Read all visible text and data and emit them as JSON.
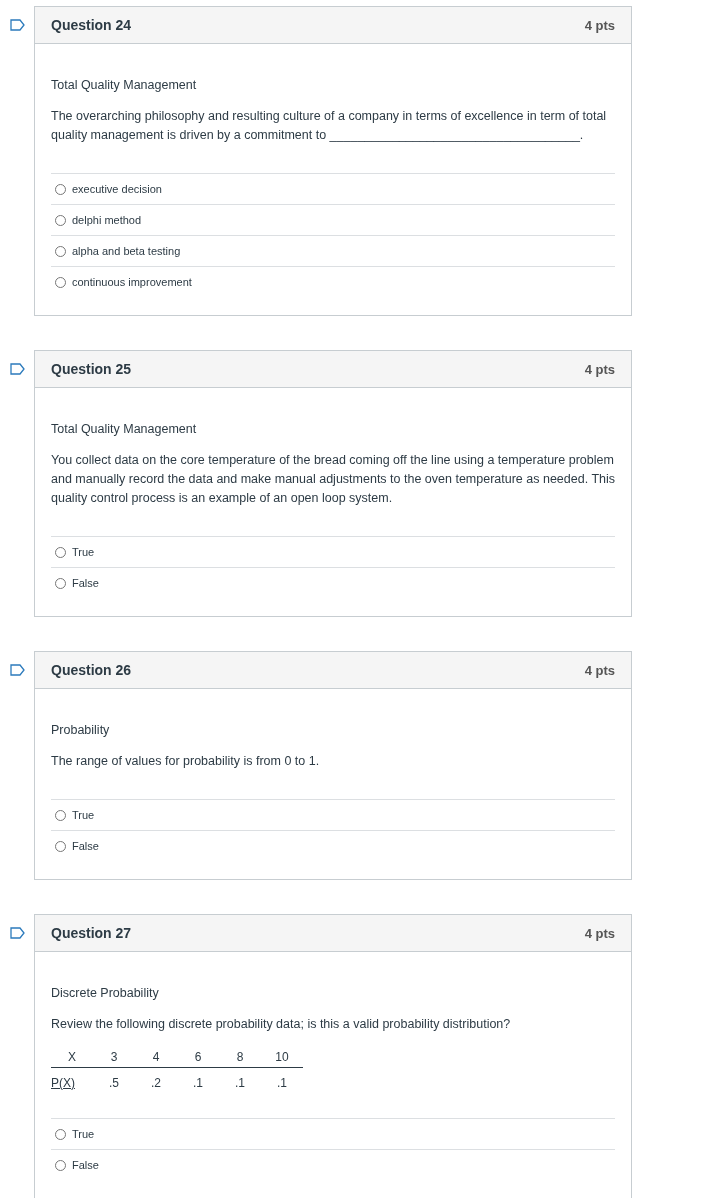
{
  "questions": [
    {
      "title": "Question 24",
      "points": "4 pts",
      "topic": "Total Quality Management",
      "text": "The overarching philosophy and resulting culture of a company in terms of excellence in term of total quality management is driven by a commitment to ____________________________________.",
      "options": [
        {
          "label": "executive decision",
          "selected": false
        },
        {
          "label": "delphi method",
          "selected": false
        },
        {
          "label": "alpha and beta testing",
          "selected": false
        },
        {
          "label": "continuous improvement",
          "selected": false
        }
      ]
    },
    {
      "title": "Question 25",
      "points": "4 pts",
      "topic": "Total Quality Management",
      "text": "You collect data on the core temperature of the bread coming off the line using a temperature problem and manually record the data and make manual adjustments to the oven temperature as needed. This quality control process is an example of an open loop system.",
      "options": [
        {
          "label": "True",
          "selected": false
        },
        {
          "label": "False",
          "selected": false
        }
      ]
    },
    {
      "title": "Question 26",
      "points": "4 pts",
      "topic": "Probability",
      "text": "The range of values for probability is from 0 to 1.",
      "options": [
        {
          "label": "True",
          "selected": false
        },
        {
          "label": "False",
          "selected": false
        }
      ]
    },
    {
      "title": "Question 27",
      "points": "4 pts",
      "topic": "Discrete Probability",
      "text": "Review the following discrete probability data; is this a valid probability distribution?",
      "table": {
        "header": [
          "X",
          "3",
          "4",
          "6",
          "8",
          "10"
        ],
        "rows": [
          [
            "P(X)",
            ".5",
            ".2",
            ".1",
            ".1",
            ".1"
          ]
        ]
      },
      "options": [
        {
          "label": "True",
          "selected": false
        },
        {
          "label": "False",
          "selected": false
        }
      ]
    }
  ]
}
